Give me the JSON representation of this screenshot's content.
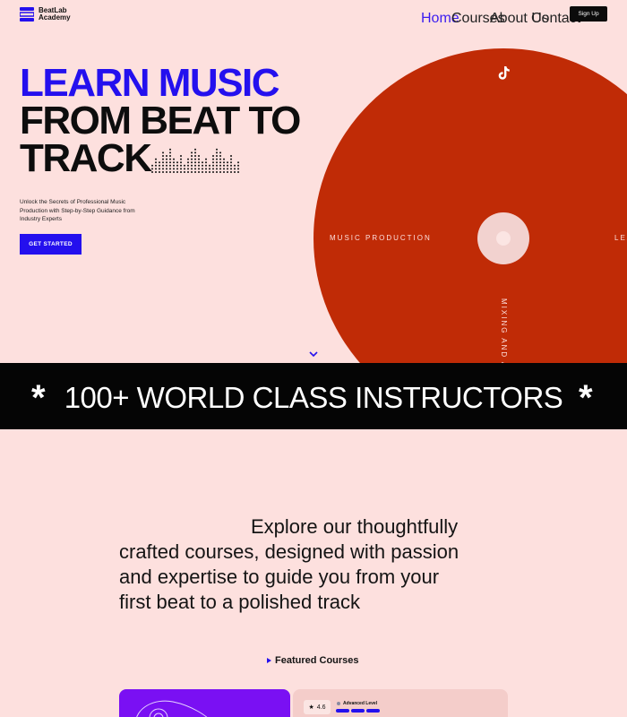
{
  "brand": {
    "name_line1": "BeatLab",
    "name_line2": "Academy"
  },
  "nav": {
    "links": [
      {
        "label": "Home",
        "active": true
      },
      {
        "label": "Courses",
        "active": false
      },
      {
        "label": "About Us",
        "active": false
      },
      {
        "label": "Contact",
        "active": false
      }
    ],
    "signup_label": "Sign Up"
  },
  "hero": {
    "title_line1": "LEARN MUSIC",
    "title_line2": "FROM BEAT TO",
    "title_line3": "TRACK",
    "subtitle": "Unlock the Secrets of Professional Music Production with Step-by-Step Guidance from Industry Experts",
    "cta_label": "GET STARTED"
  },
  "record": {
    "label_left": "MUSIC PRODUCTION",
    "label_right": "LEA",
    "label_vertical": "MIXING AND A"
  },
  "banner": {
    "text": "100+ WORLD CLASS INSTRUCTORS",
    "star": "*"
  },
  "explore": {
    "line1": "Explore our thoughtfully",
    "line2": "crafted courses, designed with passion",
    "line3": "and expertise to guide you from your",
    "line4": "first beat to a polished track"
  },
  "featured": {
    "label": "Featured Courses"
  },
  "course_card": {
    "rating": "4.6",
    "level": "Advanced Level"
  },
  "colors": {
    "accent": "#2410ee",
    "record": "#c02b06",
    "background": "#fde0de",
    "card_purple": "#7a10f3"
  }
}
